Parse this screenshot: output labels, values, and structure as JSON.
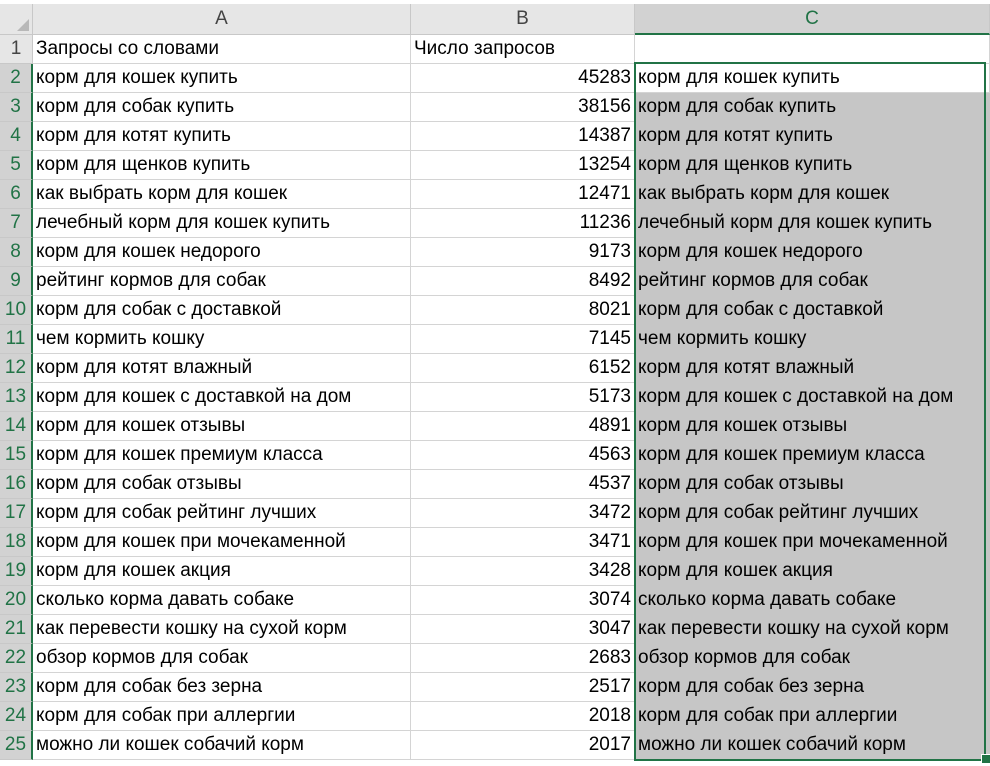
{
  "columns": [
    "A",
    "B",
    "C"
  ],
  "header_row": {
    "row_num": "1",
    "a": "Запросы со словами",
    "b": "Число запросов",
    "c": ""
  },
  "rows": [
    {
      "n": "2",
      "a": "корм для кошек купить",
      "b": "45283",
      "c": "корм для кошек купить"
    },
    {
      "n": "3",
      "a": "корм для собак купить",
      "b": "38156",
      "c": "корм для собак купить"
    },
    {
      "n": "4",
      "a": "корм для котят купить",
      "b": "14387",
      "c": "корм для котят купить"
    },
    {
      "n": "5",
      "a": "корм для щенков купить",
      "b": "13254",
      "c": "корм для щенков купить"
    },
    {
      "n": "6",
      "a": "как выбрать корм для кошек",
      "b": "12471",
      "c": "как выбрать корм для кошек"
    },
    {
      "n": "7",
      "a": "лечебный корм для кошек купить",
      "b": "11236",
      "c": "лечебный корм для кошек купить"
    },
    {
      "n": "8",
      "a": "корм для кошек недорого",
      "b": "9173",
      "c": "корм для кошек недорого"
    },
    {
      "n": "9",
      "a": "рейтинг кормов для собак",
      "b": "8492",
      "c": "рейтинг кормов для собак"
    },
    {
      "n": "10",
      "a": "корм для собак с доставкой",
      "b": "8021",
      "c": "корм для собак с доставкой"
    },
    {
      "n": "11",
      "a": "чем кормить кошку",
      "b": "7145",
      "c": "чем кормить кошку"
    },
    {
      "n": "12",
      "a": "корм для котят влажный",
      "b": "6152",
      "c": "корм для котят влажный"
    },
    {
      "n": "13",
      "a": "корм для кошек с доставкой на дом",
      "b": "5173",
      "c": "корм для кошек с доставкой на дом"
    },
    {
      "n": "14",
      "a": "корм для кошек отзывы",
      "b": "4891",
      "c": "корм для кошек отзывы"
    },
    {
      "n": "15",
      "a": "корм для кошек премиум класса",
      "b": "4563",
      "c": "корм для кошек премиум класса"
    },
    {
      "n": "16",
      "a": "корм для собак отзывы",
      "b": "4537",
      "c": "корм для собак отзывы"
    },
    {
      "n": "17",
      "a": "корм для собак рейтинг лучших",
      "b": "3472",
      "c": "корм для собак рейтинг лучших"
    },
    {
      "n": "18",
      "a": "корм для кошек при мочекаменной",
      "b": "3471",
      "c": "корм для кошек при мочекаменной"
    },
    {
      "n": "19",
      "a": "корм для кошек акция",
      "b": "3428",
      "c": "корм для кошек акция"
    },
    {
      "n": "20",
      "a": "сколько корма давать собаке",
      "b": "3074",
      "c": "сколько корма давать собаке"
    },
    {
      "n": "21",
      "a": "как перевести кошку на сухой корм",
      "b": "3047",
      "c": "как перевести кошку на сухой корм"
    },
    {
      "n": "22",
      "a": "обзор кормов для собак",
      "b": "2683",
      "c": "обзор кормов для собак"
    },
    {
      "n": "23",
      "a": "корм для собак без зерна",
      "b": "2517",
      "c": "корм для собак без зерна"
    },
    {
      "n": "24",
      "a": "корм для собак при аллергии",
      "b": "2018",
      "c": "корм для собак при аллергии"
    },
    {
      "n": "25",
      "a": "можно ли кошек собачий корм",
      "b": "2017",
      "c": "можно ли кошек собачий корм"
    }
  ],
  "selection": {
    "active_column": "C",
    "range": "C2:C25"
  },
  "colors": {
    "accent": "#217346",
    "selection_fill": "#c6c6c6",
    "header_bg": "#e6e6e6",
    "gridline": "#d4d4d4"
  }
}
